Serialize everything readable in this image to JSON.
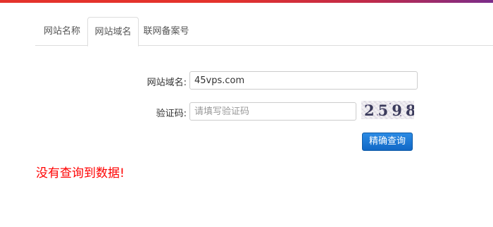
{
  "tabs": [
    {
      "label": "网站名称",
      "active": false
    },
    {
      "label": "网站域名",
      "active": true
    },
    {
      "label": "联网备案号",
      "active": false
    }
  ],
  "form": {
    "domain_label": "网站域名:",
    "domain_value": "45vps.com",
    "captcha_label": "验证码:",
    "captcha_placeholder": "请填写验证码",
    "captcha_text": "2598",
    "submit_label": "精确查询"
  },
  "result": {
    "message": "没有查询到数据!"
  },
  "colors": {
    "accent_bar": "#e4322b",
    "button": "#1a73d1",
    "message": "#ff0000"
  }
}
